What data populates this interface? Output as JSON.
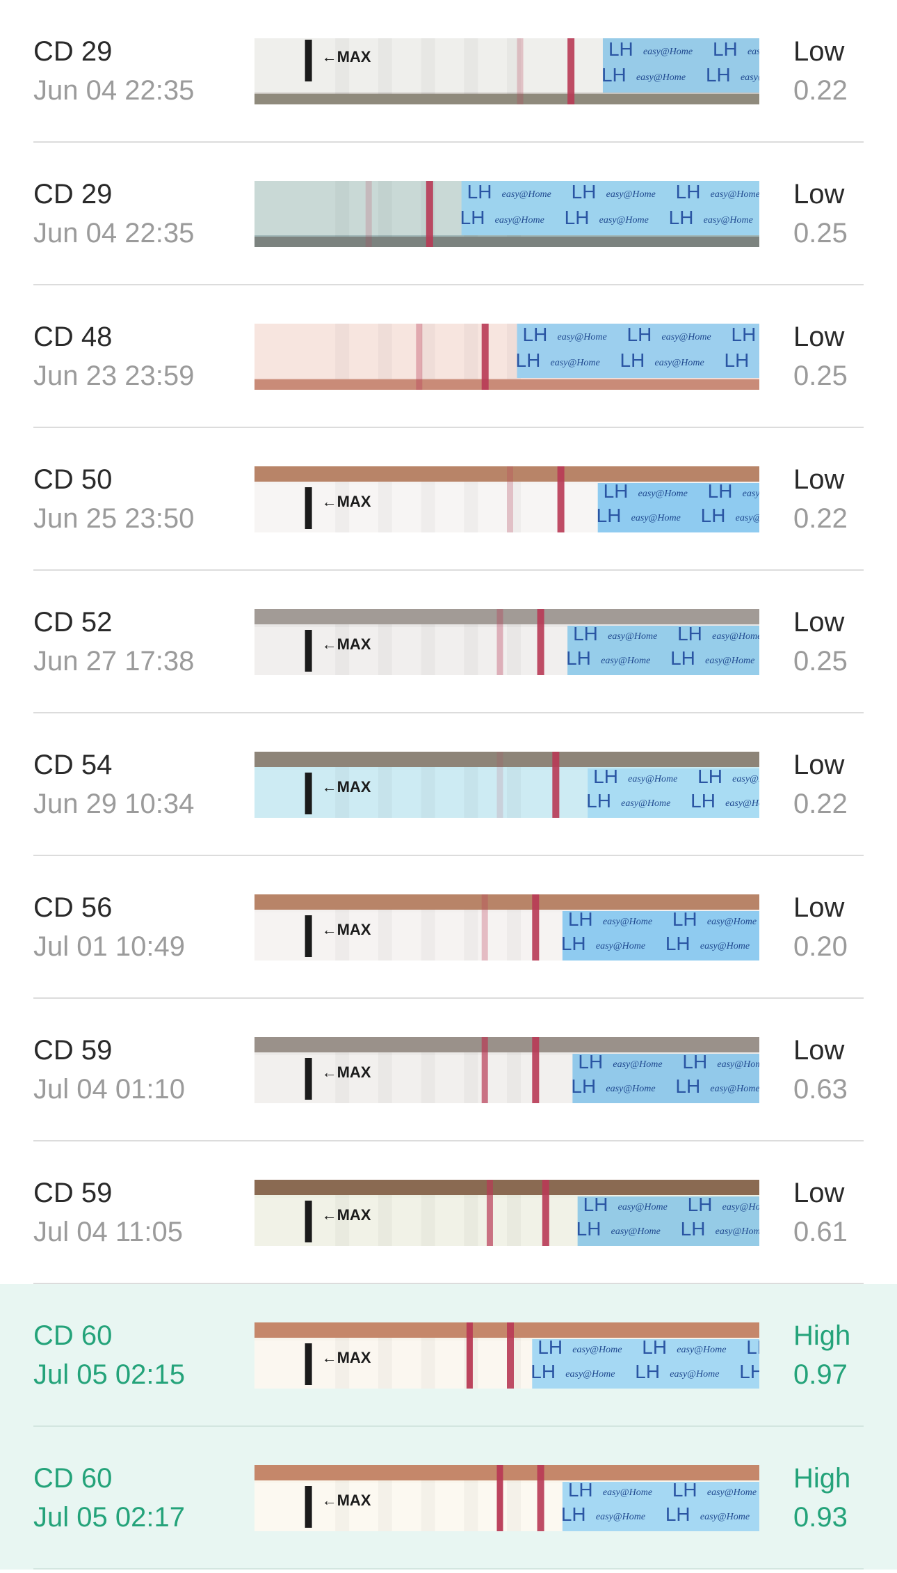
{
  "colors": {
    "high_accent": "#24a37a",
    "high_row_background": "#e8f6f2",
    "label_text": "#2a2a2a",
    "secondary_text": "#9b9b9b",
    "strip_blue": "#9ed3ee",
    "test_line": "#b83a55"
  },
  "strip_labels": {
    "max": "←MAX",
    "lh": "LH",
    "brand": "easy@Home"
  },
  "tests": [
    {
      "cycle_day": "CD 29",
      "timestamp": "Jun 04 22:35",
      "status": "Low",
      "value": "0.22",
      "level": "low",
      "photo": {
        "bg": "#c6c2bc",
        "strip": "#efefec",
        "blue": "#97cbe8",
        "edge": "#8f8a7c",
        "edge_top": false,
        "max": true,
        "control": 0.62,
        "test": 0.52,
        "test_intensity": 0.25,
        "blue_start": 0.69
      }
    },
    {
      "cycle_day": "CD 29",
      "timestamp": "Jun 04 22:35",
      "status": "Low",
      "value": "0.25",
      "level": "low",
      "photo": {
        "bg": "#9fb6b6",
        "strip": "#c9d9d6",
        "blue": "#9dd3ee",
        "edge": "#7c837f",
        "edge_top": false,
        "max": false,
        "control": 0.34,
        "test": 0.22,
        "test_intensity": 0.2,
        "blue_start": 0.41
      }
    },
    {
      "cycle_day": "CD 48",
      "timestamp": "Jun 23 23:59",
      "status": "Low",
      "value": "0.25",
      "level": "low",
      "photo": {
        "bg": "#f3dcd6",
        "strip": "#f7e5df",
        "blue": "#9ccfee",
        "edge": "#c98b78",
        "edge_top": false,
        "max": false,
        "control": 0.45,
        "test": 0.32,
        "test_intensity": 0.35,
        "blue_start": 0.52
      }
    },
    {
      "cycle_day": "CD 50",
      "timestamp": "Jun 25 23:50",
      "status": "Low",
      "value": "0.22",
      "level": "low",
      "photo": {
        "bg": "#f5f3f2",
        "strip": "#f7f5f4",
        "blue": "#8fcbf0",
        "edge": "#b88468",
        "edge_top": true,
        "max": true,
        "control": 0.6,
        "test": 0.5,
        "test_intensity": 0.25,
        "blue_start": 0.68
      }
    },
    {
      "cycle_day": "CD 52",
      "timestamp": "Jun 27 17:38",
      "status": "Low",
      "value": "0.25",
      "level": "low",
      "photo": {
        "bg": "#e9e7e6",
        "strip": "#f1efee",
        "blue": "#96cdea",
        "edge": "#a29b96",
        "edge_top": true,
        "max": true,
        "control": 0.56,
        "test": 0.48,
        "test_intensity": 0.35,
        "blue_start": 0.62
      }
    },
    {
      "cycle_day": "CD 54",
      "timestamp": "Jun 29 10:34",
      "status": "Low",
      "value": "0.22",
      "level": "low",
      "photo": {
        "bg": "#c9eaf2",
        "strip": "#cdebf3",
        "blue": "#a9dcf3",
        "edge": "#8d8478",
        "edge_top": true,
        "max": true,
        "control": 0.59,
        "test": 0.48,
        "test_intensity": 0.15,
        "blue_start": 0.66
      }
    },
    {
      "cycle_day": "CD 56",
      "timestamp": "Jul 01 10:49",
      "status": "Low",
      "value": "0.20",
      "level": "low",
      "photo": {
        "bg": "#f3f0ef",
        "strip": "#f6f3f2",
        "blue": "#8fcbf0",
        "edge": "#b88468",
        "edge_top": true,
        "max": true,
        "control": 0.55,
        "test": 0.45,
        "test_intensity": 0.3,
        "blue_start": 0.61
      }
    },
    {
      "cycle_day": "CD 59",
      "timestamp": "Jul 04 01:10",
      "status": "Low",
      "value": "0.63",
      "level": "low",
      "photo": {
        "bg": "#eceae8",
        "strip": "#f2f0ee",
        "blue": "#92c9ea",
        "edge": "#9a918a",
        "edge_top": true,
        "max": true,
        "control": 0.55,
        "test": 0.45,
        "test_intensity": 0.7,
        "blue_start": 0.63
      }
    },
    {
      "cycle_day": "CD 59",
      "timestamp": "Jul 04 11:05",
      "status": "Low",
      "value": "0.61",
      "level": "low",
      "photo": {
        "bg": "#eef0e3",
        "strip": "#f1f2e7",
        "blue": "#95cbe6",
        "edge": "#8a6a52",
        "edge_top": true,
        "max": true,
        "control": 0.57,
        "test": 0.46,
        "test_intensity": 0.7,
        "blue_start": 0.64
      }
    },
    {
      "cycle_day": "CD 60",
      "timestamp": "Jul 05 02:15",
      "status": "High",
      "value": "0.97",
      "level": "high",
      "photo": {
        "bg": "#f8f3ea",
        "strip": "#fbf7f0",
        "blue": "#a5d8f3",
        "edge": "#c5876a",
        "edge_top": true,
        "max": true,
        "control": 0.5,
        "test": 0.42,
        "test_intensity": 0.95,
        "blue_start": 0.55
      }
    },
    {
      "cycle_day": "CD 60",
      "timestamp": "Jul 05 02:17",
      "status": "High",
      "value": "0.93",
      "level": "high",
      "photo": {
        "bg": "#faf6ec",
        "strip": "#fcf9f1",
        "blue": "#a5d8f3",
        "edge": "#c5876a",
        "edge_top": true,
        "max": true,
        "control": 0.56,
        "test": 0.48,
        "test_intensity": 0.95,
        "blue_start": 0.61
      }
    }
  ]
}
